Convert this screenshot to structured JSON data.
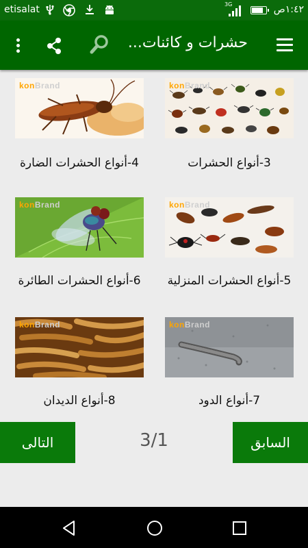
{
  "status_bar": {
    "carrier": "etisalat",
    "time": "١:٤٢ص",
    "network": "3G",
    "icons": [
      "usb-icon",
      "chrome-icon",
      "download-icon",
      "android-icon",
      "signal-icon",
      "battery-icon"
    ]
  },
  "toolbar": {
    "title": "حشرات و كائنات...",
    "icons": [
      "hamburger-icon",
      "search-icon",
      "share-icon",
      "more-vert-icon"
    ]
  },
  "grid": {
    "brand_text": "konBrand",
    "brand_part1": "kon",
    "brand_part2": "Brand",
    "items": [
      {
        "caption": "3-أنواع الحشرات",
        "image": "many-insects"
      },
      {
        "caption": "4-أنواع الحشرات الضارة",
        "image": "cockroach"
      },
      {
        "caption": "5-أنواع الحشرات المنزلية",
        "image": "household-insects"
      },
      {
        "caption": "6-أنواع الحشرات الطائرة",
        "image": "fly-on-leaf"
      },
      {
        "caption": "7-أنواع الدود",
        "image": "millipede"
      },
      {
        "caption": "8-أنواع الديدان",
        "image": "mealworms"
      }
    ]
  },
  "pager": {
    "prev_label": "السابق",
    "next_label": "التالى",
    "page_indicator": "3/1"
  },
  "colors": {
    "toolbar": "#006600",
    "status_bar": "#0b6b0b",
    "button": "#0a7a0a",
    "background": "#ececec",
    "brand_orange": "#ffa500"
  }
}
